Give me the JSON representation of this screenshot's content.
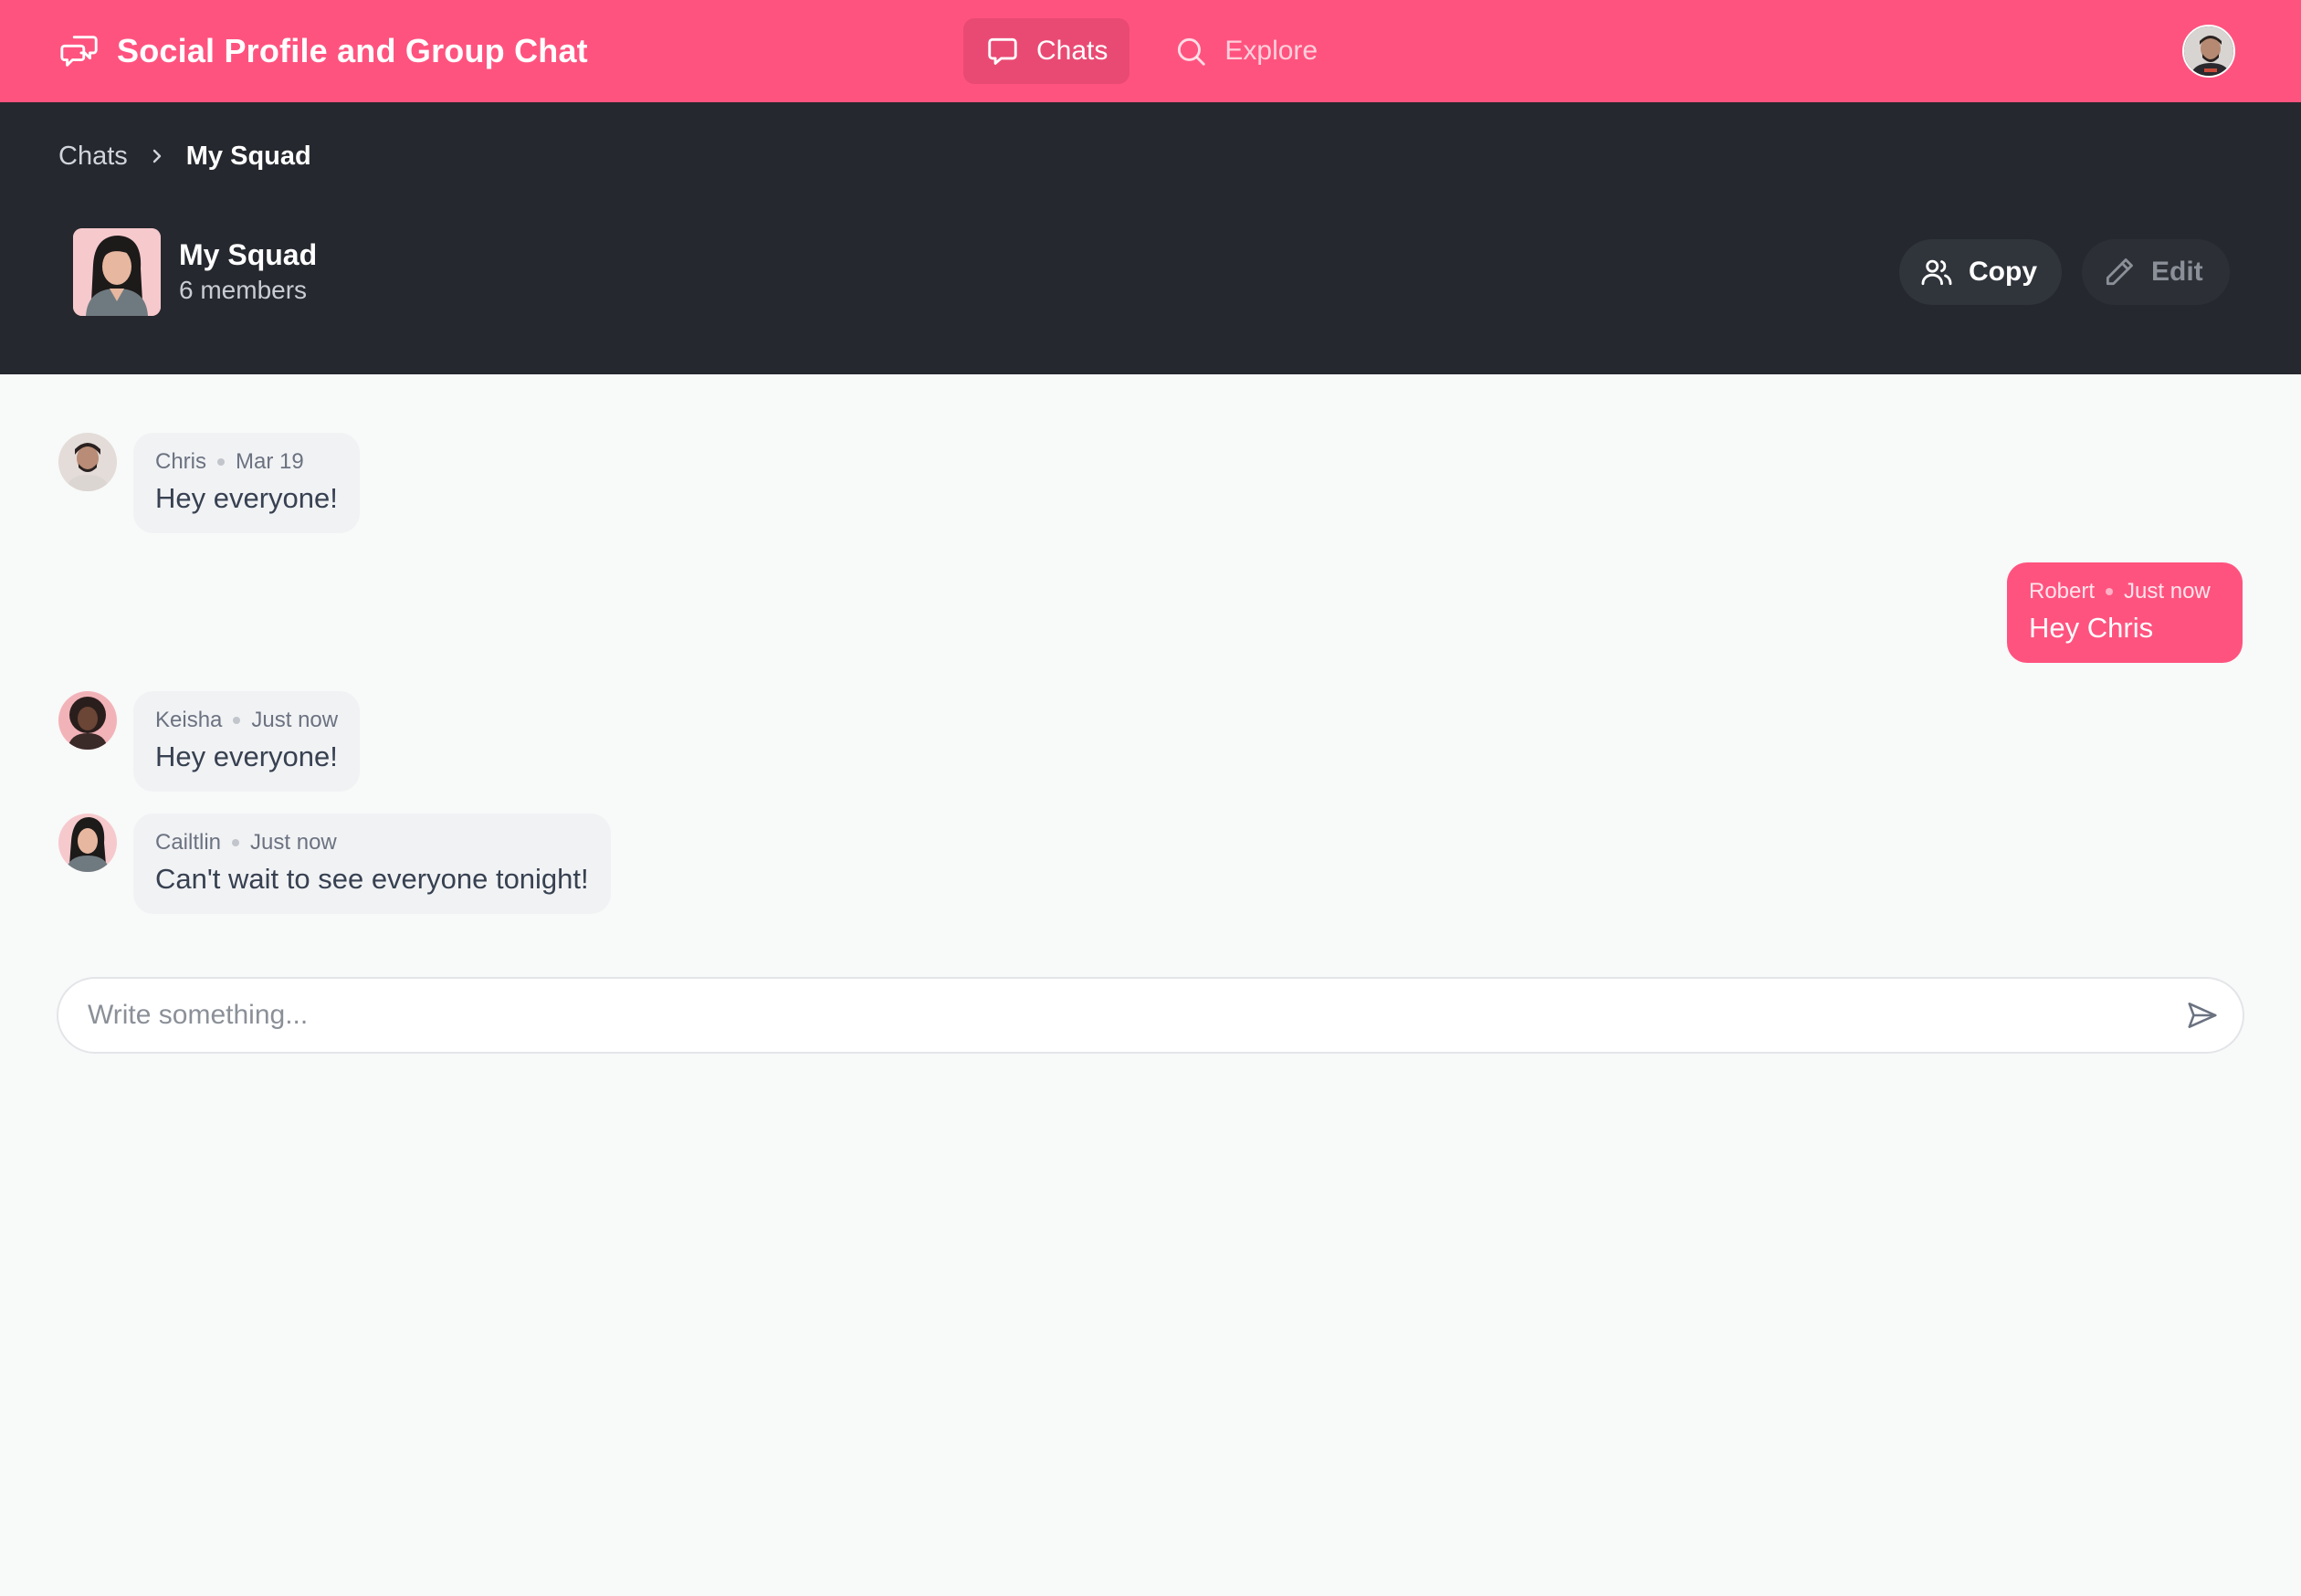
{
  "app": {
    "title": "Social Profile and Group Chat",
    "brand_color": "#ff537f",
    "header_color": "#25282e"
  },
  "nav": {
    "items": [
      {
        "label": "Chats",
        "icon": "chat-bubble-icon",
        "active": true
      },
      {
        "label": "Explore",
        "icon": "search-icon",
        "active": false
      }
    ]
  },
  "breadcrumb": {
    "parent": "Chats",
    "current": "My Squad"
  },
  "group": {
    "name": "My Squad",
    "members": "6 members"
  },
  "actions": {
    "copy_label": "Copy",
    "edit_label": "Edit"
  },
  "messages": [
    {
      "author": "Chris",
      "time": "Mar 19",
      "text": "Hey everyone!",
      "mine": false
    },
    {
      "author": "Robert",
      "time": "Just now",
      "text": "Hey Chris",
      "mine": true
    },
    {
      "author": "Keisha",
      "time": "Just now",
      "text": "Hey everyone!",
      "mine": false
    },
    {
      "author": "Cailtlin",
      "time": "Just now",
      "text": "Can't wait to see everyone tonight!",
      "mine": false
    }
  ],
  "composer": {
    "placeholder": "Write something..."
  }
}
